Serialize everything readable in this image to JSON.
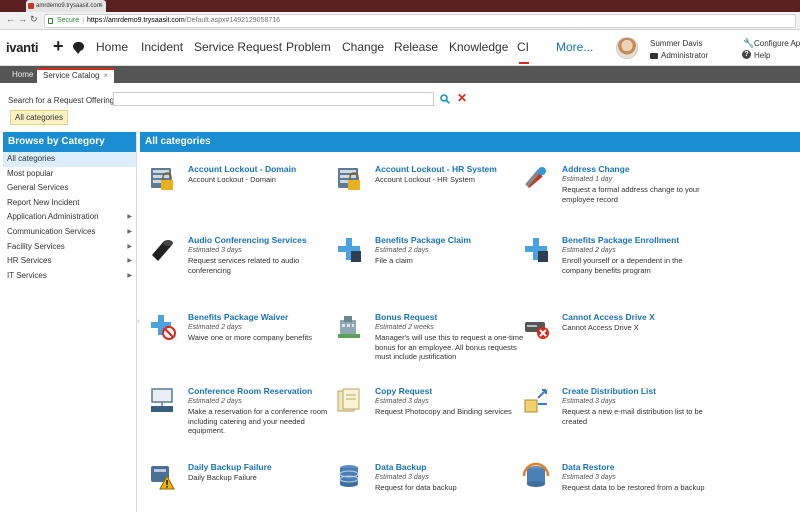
{
  "browser": {
    "tab_title": "amrdemo9.trysaasit.com",
    "url_secure": "Secure",
    "url_host": "https://amrdemo9.trysaasit.com",
    "url_path": "/Default.aspx#1492129058716"
  },
  "header": {
    "logo": "ivanti",
    "nav": [
      "Home",
      "Incident",
      "Service Request",
      "Problem",
      "Change",
      "Release",
      "Knowledge",
      "CI",
      "More..."
    ],
    "user_name": "Summer Davis",
    "user_role": "Administrator",
    "configure_label": "Configure App",
    "help_label": "Help"
  },
  "tabs": [
    {
      "label": "Home"
    },
    {
      "label": "Service Catalog",
      "close": "×"
    }
  ],
  "search": {
    "label": "Search for a Request Offering:",
    "value": "",
    "clear_glyph": "✕"
  },
  "active_filter": "All categories",
  "sidebar": {
    "title": "Browse by Category",
    "items": [
      {
        "label": "All categories"
      },
      {
        "label": "Most popular"
      },
      {
        "label": "General Services"
      },
      {
        "label": "Report New Incident"
      },
      {
        "label": "Application Administration"
      },
      {
        "label": "Communication Services"
      },
      {
        "label": "Facility Services"
      },
      {
        "label": "HR Services"
      },
      {
        "label": "IT Services"
      }
    ],
    "arrow": "▶"
  },
  "main": {
    "title": "All categories",
    "offerings": [
      {
        "title": "Account Lockout - Domain",
        "estimate": "",
        "desc": "Account Lockout - Domain",
        "icon": "server-lock-icon"
      },
      {
        "title": "Account Lockout - HR System",
        "estimate": "",
        "desc": "Account Lockout - HR System",
        "icon": "server-lock-icon"
      },
      {
        "title": "Address Change",
        "estimate": "Estimated 1 day",
        "desc": "Request a formal address change to your employee record",
        "icon": "tools-icon"
      },
      {
        "title": "Audio Conferencing Services",
        "estimate": "Estimated 3 days",
        "desc": "Request services related to audio conferencing",
        "icon": "speaker-icon"
      },
      {
        "title": "Benefits Package Claim",
        "estimate": "Estimated 2 days",
        "desc": "File a claim",
        "icon": "medical-icon"
      },
      {
        "title": "Benefits Package Enrollment",
        "estimate": "Estimated 2 days",
        "desc": "Enroll yourself or a dependent in the company benefits program",
        "icon": "medical-icon"
      },
      {
        "title": "Benefits Package Waiver",
        "estimate": "Estimated 2 days",
        "desc": "Waive one or more company benefits",
        "icon": "medical-no-icon"
      },
      {
        "title": "Bonus Request",
        "estimate": "Estimated 2 weeks",
        "desc": "Manager's will use this to request a one-time bonus for an employee. All bonus requests must include justification",
        "icon": "building-icon"
      },
      {
        "title": "Cannot Access Drive X",
        "estimate": "",
        "desc": "Cannot Access Drive X",
        "icon": "drive-error-icon"
      },
      {
        "title": "Conference Room Reservation",
        "estimate": "Estimated 2 days",
        "desc": "Make a reservation for a conference room including catering and your needed equipment.",
        "icon": "projector-icon"
      },
      {
        "title": "Copy Request",
        "estimate": "Estimated 3 days",
        "desc": "Request Photocopy and Binding services",
        "icon": "documents-icon"
      },
      {
        "title": "Create Distribution List",
        "estimate": "Estimated 3 days",
        "desc": "Request a new e-mail distribution list to be created",
        "icon": "distribution-icon"
      },
      {
        "title": "Daily Backup Failure",
        "estimate": "",
        "desc": "Daily Backup Failure",
        "icon": "backup-warning-icon"
      },
      {
        "title": "Data Backup",
        "estimate": "Estimated 3 days",
        "desc": "Request for data backup",
        "icon": "database-icon"
      },
      {
        "title": "Data Restore",
        "estimate": "Estimated 3 days",
        "desc": "Request data to be restored from a backup",
        "icon": "database-restore-icon"
      }
    ]
  },
  "colors": {
    "accent": "#1b8ed2",
    "link": "#1a73b8",
    "brand_red": "#d52b1e",
    "tabbar": "#555555"
  }
}
